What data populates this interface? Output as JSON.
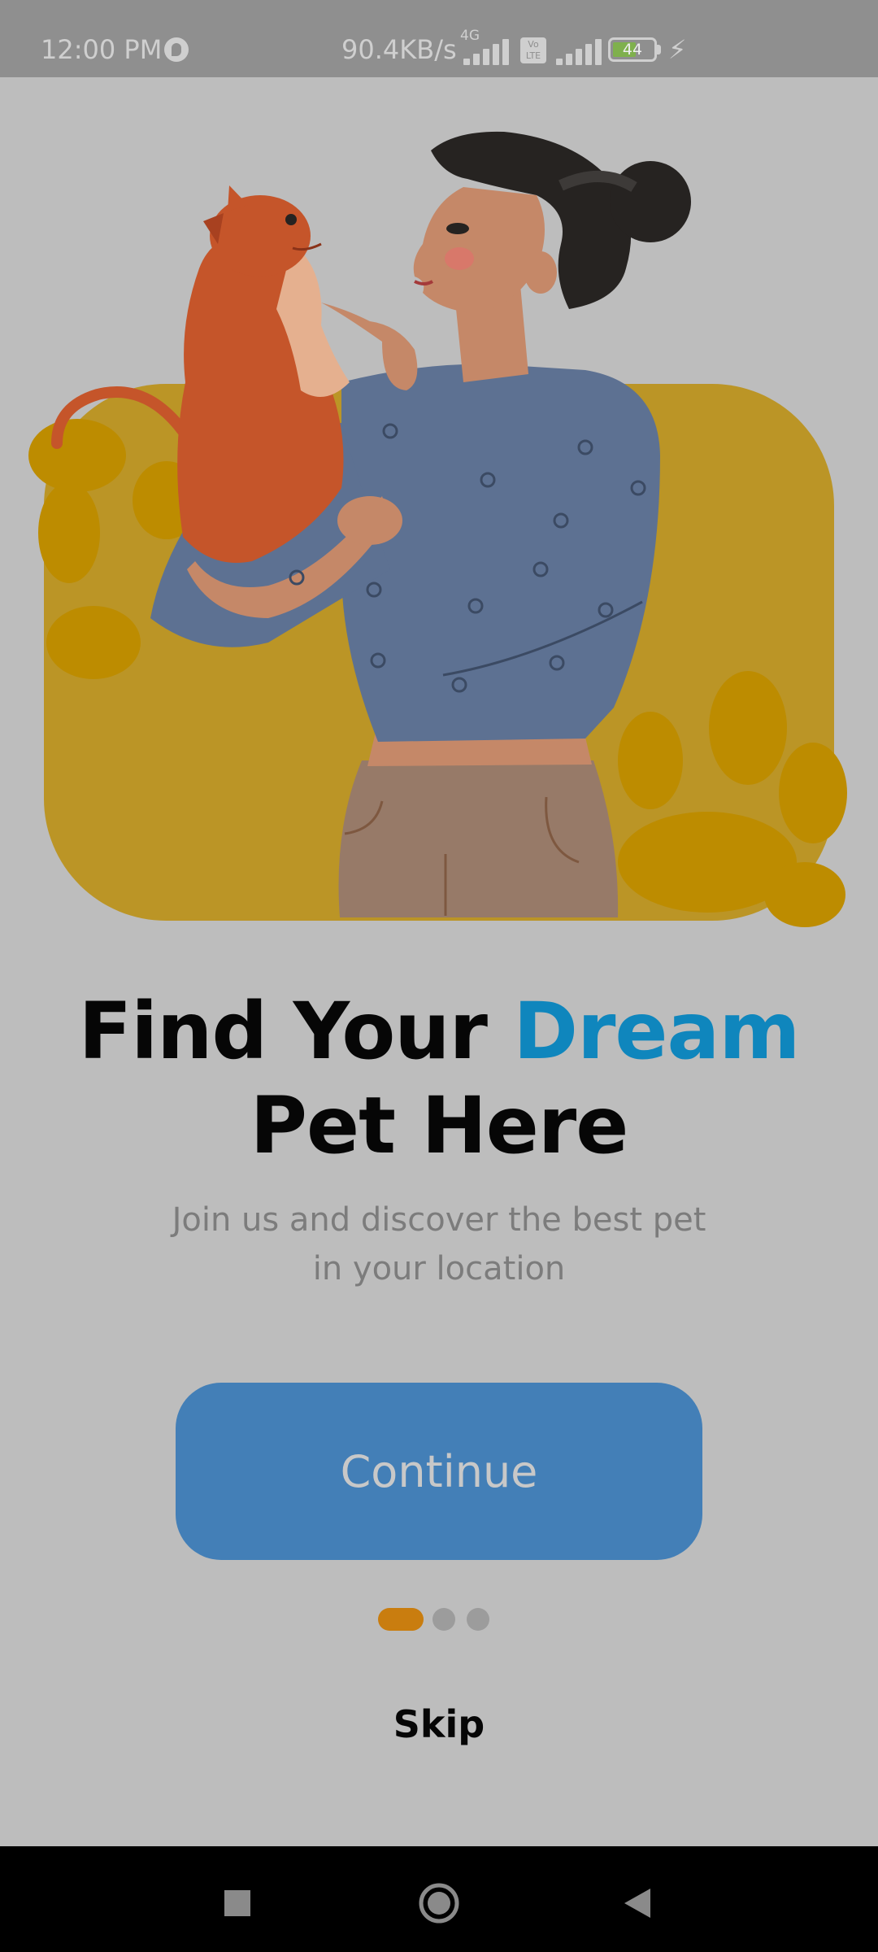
{
  "status_bar": {
    "time": "12:00 PM",
    "net_speed": "90.4KB/s",
    "network_type": "4G",
    "volte": "Vo LTE",
    "battery": "44",
    "icons": [
      "sync-icon",
      "signal-icon",
      "volte-icon",
      "signal-icon",
      "battery-icon",
      "charging-icon"
    ]
  },
  "hero": {
    "image_name": "woman-holding-cat-illustration",
    "colors": {
      "card": "#bb9526",
      "paw": "#bd8c00",
      "cat": "#c5552a",
      "sweater": "#5d7192",
      "hair": "#262321",
      "skin": "#c58868",
      "pants": "#977a68"
    }
  },
  "headline": {
    "part1": "Find Your ",
    "highlight": "Dream",
    "part2": "Pet Here"
  },
  "subtitle": "Join us and discover the best pet in your location",
  "continue_label": "Continue",
  "pagination": {
    "total": 3,
    "active": 1
  },
  "skip_label": "Skip",
  "colors": {
    "accent": "#0f86bd",
    "button": "#437fb7",
    "active_dot": "#c97d0f",
    "overlay_background": "#bdbdbd"
  },
  "nav_bar": {
    "icons": [
      "recents-icon",
      "home-icon",
      "back-icon"
    ]
  }
}
